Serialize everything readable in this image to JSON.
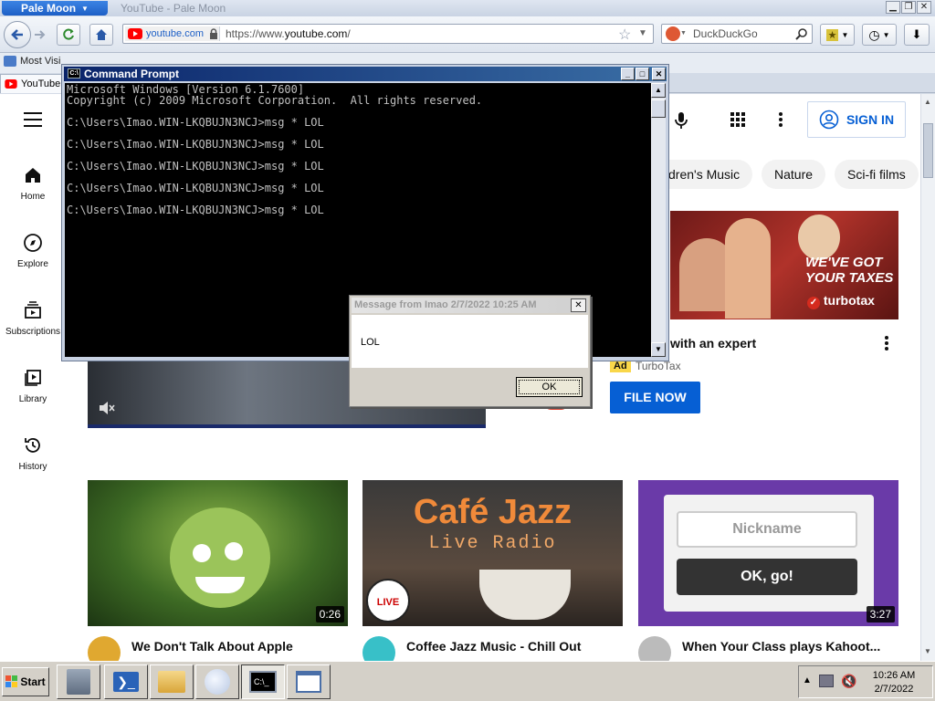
{
  "browser": {
    "app_menu_label": "Pale Moon",
    "window_title": "YouTube - Pale Moon",
    "site_identity": "youtube.com",
    "url_prefix": "https://www.",
    "url_host": "youtube.com",
    "url_suffix": "/",
    "search_placeholder": "DuckDuckGo",
    "bookmark_label": "Most Visi",
    "tab_label": "YouTube"
  },
  "youtube": {
    "sidebar": [
      {
        "label": "Home"
      },
      {
        "label": "Explore"
      },
      {
        "label": "Subscriptions"
      },
      {
        "label": "Library"
      },
      {
        "label": "History"
      }
    ],
    "sign_in_label": "SIGN IN",
    "chips": [
      "dren's Music",
      "Nature",
      "Sci-fi films"
    ],
    "ad": {
      "headline": "with an expert",
      "badge": "Ad",
      "advertiser": "TurboTax",
      "cta": "FILE NOW",
      "banner_line1": "WE'VE GOT",
      "banner_line2": "YOUR TAXES",
      "brand": "turbotax"
    },
    "videos": [
      {
        "title": "We Don't Talk About Apple",
        "duration": "0:26"
      },
      {
        "title": "Coffee Jazz Music - Chill Out",
        "duration": "",
        "thumb_line1": "Café Jazz",
        "thumb_line2": "Live Radio",
        "live_badge": "LIVE"
      },
      {
        "title": "When Your Class plays Kahoot...",
        "duration": "3:27",
        "nickname_placeholder": "Nickname",
        "go_button": "OK, go!"
      }
    ]
  },
  "cmd": {
    "title": "Command Prompt",
    "lines": [
      "Microsoft Windows [Version 6.1.7600]",
      "Copyright (c) 2009 Microsoft Corporation.  All rights reserved.",
      "",
      "C:\\Users\\Imao.WIN-LKQBUJN3NCJ>msg * LOL",
      "",
      "C:\\Users\\Imao.WIN-LKQBUJN3NCJ>msg * LOL",
      "",
      "C:\\Users\\Imao.WIN-LKQBUJN3NCJ>msg * LOL",
      "",
      "C:\\Users\\Imao.WIN-LKQBUJN3NCJ>msg * LOL",
      "",
      "C:\\Users\\Imao.WIN-LKQBUJN3NCJ>msg * LOL"
    ]
  },
  "message": {
    "title": "Message from Imao 2/7/2022 10:25 AM",
    "text": "LOL",
    "ok_label": "OK"
  },
  "taskbar": {
    "start_label": "Start",
    "time": "10:26 AM",
    "date": "2/7/2022"
  }
}
